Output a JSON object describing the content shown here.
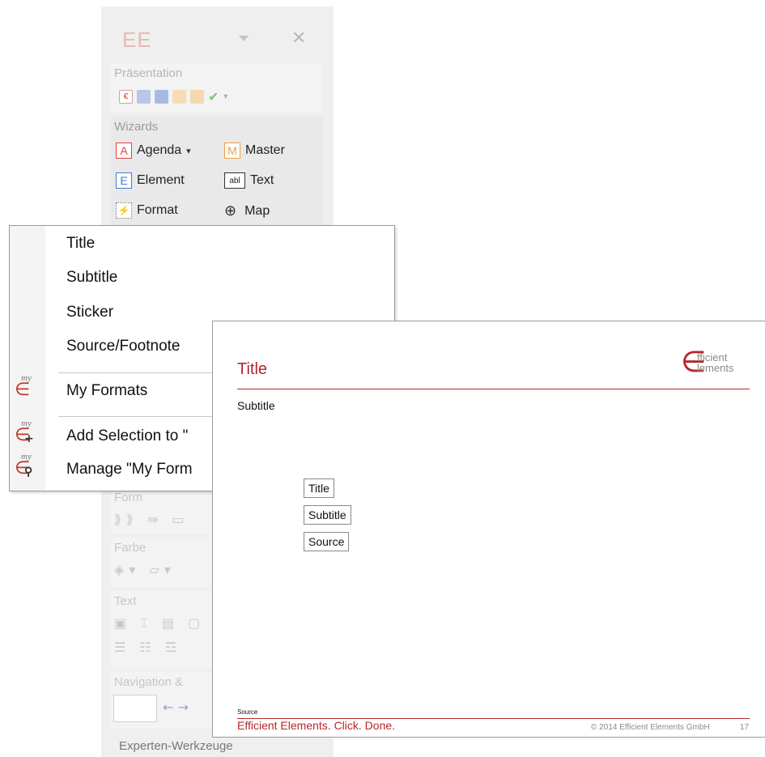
{
  "panel": {
    "logo": "EE",
    "close_glyph": "✕",
    "presentation": {
      "title": "Präsentation",
      "icons": [
        "euro-doc-icon",
        "save-edit-icon",
        "save-grid-icon",
        "mail-icon",
        "mail-list-icon",
        "check-icon",
        "dropdown-icon"
      ]
    },
    "wizards": {
      "title": "Wizards",
      "items": [
        {
          "label": "Agenda",
          "icon": "A",
          "dropdown": "▾",
          "color": "#e8433a"
        },
        {
          "label": "Master",
          "icon": "M",
          "color": "#f0a040"
        },
        {
          "label": "Element",
          "icon": "E",
          "color": "#3d7fd1"
        },
        {
          "label": "Text",
          "icon": "abl",
          "color": "#222222"
        },
        {
          "label": "Format",
          "icon": "format-icon",
          "color": "#e8a030"
        },
        {
          "label": "Map",
          "icon": "globe-icon",
          "color": "#222222"
        }
      ]
    },
    "form": {
      "title": "Form"
    },
    "farbe": {
      "title": "Farbe"
    },
    "text": {
      "title": "Text"
    },
    "navigation": {
      "title": "Navigation &"
    },
    "experten": {
      "title": "Experten-Werkzeuge"
    }
  },
  "menu": {
    "items": [
      "Title",
      "Subtitle",
      "Sticker",
      "Source/Footnote"
    ],
    "my_formats": "My Formats",
    "add_selection": "Add Selection to \"",
    "manage": "Manage \"My Form",
    "my_label": "my"
  },
  "slide": {
    "title": "Title",
    "subtitle": "Subtitle",
    "boxes": [
      "Title",
      "Subtitle",
      "Source"
    ],
    "source": "Source",
    "footer": "Efficient Elements. Click. Done.",
    "copyright": "© 2014 Efficient Elements GmbH",
    "page": "17",
    "brand_line1": "fficient",
    "brand_line2": "lements",
    "accent": "#b5262a"
  }
}
